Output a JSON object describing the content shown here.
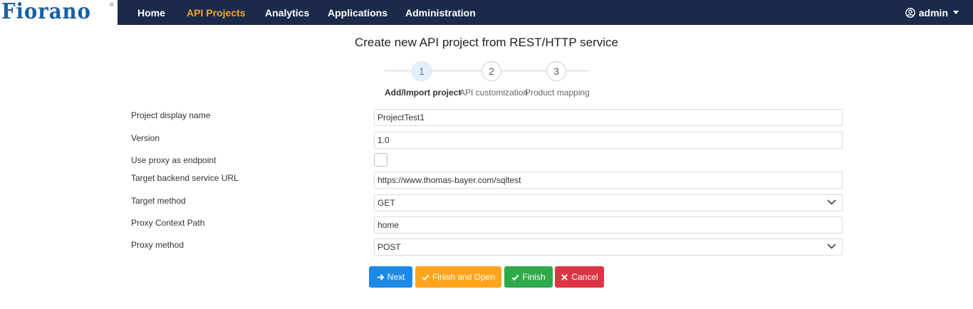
{
  "brand": {
    "logo_text": "Fiorano",
    "logo_mark": "®"
  },
  "nav": {
    "items": [
      {
        "label": "Home"
      },
      {
        "label": "API Projects"
      },
      {
        "label": "Analytics"
      },
      {
        "label": "Applications"
      },
      {
        "label": "Administration"
      }
    ],
    "active": "API Projects",
    "user": {
      "label": "admin",
      "icon": "user-circle-icon"
    }
  },
  "page": {
    "title": "Create new API project from REST/HTTP service"
  },
  "stepper": {
    "current": 1,
    "steps": [
      {
        "number": "1",
        "label": "Add/Import project"
      },
      {
        "number": "2",
        "label": "API customization"
      },
      {
        "number": "3",
        "label": "Product mapping"
      }
    ]
  },
  "form": {
    "project_display_name": {
      "label": "Project display name",
      "value": "ProjectTest1"
    },
    "version": {
      "label": "Version",
      "value": "1.0"
    },
    "use_proxy": {
      "label": "Use proxy as endpoint",
      "checked": false
    },
    "target_url": {
      "label": "Target backend service URL",
      "value": "https://www.thomas-bayer.com/sqltest"
    },
    "target_method": {
      "label": "Target method",
      "value": "GET"
    },
    "proxy_context_path": {
      "label": "Proxy Context Path",
      "value": "home"
    },
    "proxy_method": {
      "label": "Proxy method",
      "value": "POST"
    }
  },
  "buttons": {
    "next": {
      "label": "Next",
      "icon": "arrow-right-icon"
    },
    "finish_and_open": {
      "label": "Finish and Open",
      "icon": "check-icon"
    },
    "finish": {
      "label": "Finish",
      "icon": "check-icon"
    },
    "cancel": {
      "label": "Cancel",
      "icon": "close-icon"
    }
  },
  "colors": {
    "navbar": "#1b2a4a",
    "active_nav": "#f5a623",
    "logo": "#1a5fa8",
    "next": "#1e88e5",
    "finish_and_open": "#ffa41c",
    "finish": "#2eaa4a",
    "cancel": "#dc3545"
  }
}
